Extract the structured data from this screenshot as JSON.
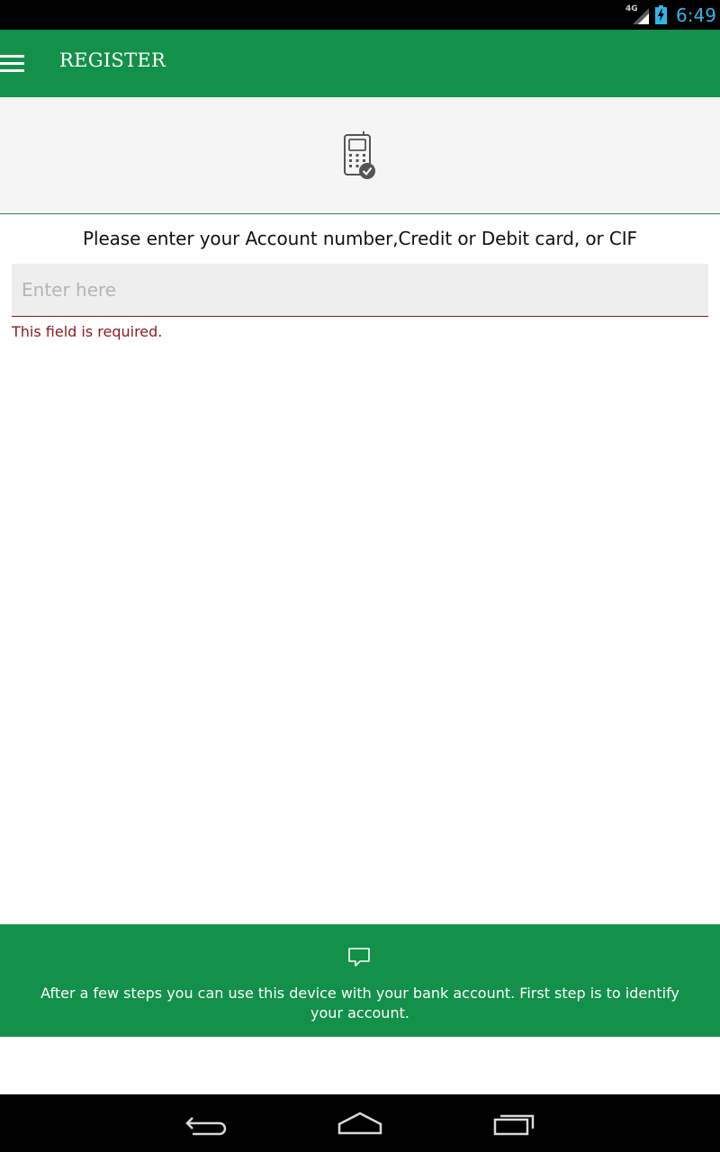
{
  "status_bar": {
    "network": "4G",
    "time": "6:49",
    "time_color": "#33b5e5"
  },
  "app_bar": {
    "title": "REGISTER",
    "color": "#13904a",
    "menu_icon": "hamburger-menu-icon"
  },
  "header": {
    "icon": "phone-check-icon"
  },
  "form": {
    "prompt": "Please enter your Account number,Credit or Debit card, or CIF",
    "input_placeholder": "Enter here",
    "input_value": "",
    "error": "This field is required.",
    "error_color": "#8b1a1a"
  },
  "info": {
    "icon": "chat-bubble-icon",
    "text": "After a few steps you can use this device with your bank account. First step is to identify your account."
  },
  "nav_bar": {
    "back_icon": "back-icon",
    "home_icon": "home-icon",
    "recent_icon": "recent-apps-icon"
  }
}
